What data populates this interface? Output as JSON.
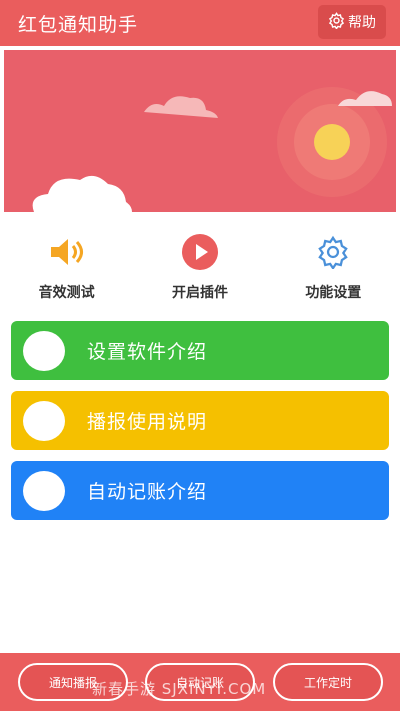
{
  "header": {
    "title": "红包通知助手",
    "help_label": "帮助",
    "help_icon": "gear-icon"
  },
  "colors": {
    "header": "#ea5d5d",
    "banner": "#e8606a",
    "card_green": "#3fbf3f",
    "card_yellow": "#f5c000",
    "card_blue": "#2082f6",
    "action_icon": "#f5a623",
    "play_icon": "#ea5d5d",
    "settings_icon": "#4a90d9"
  },
  "actions": [
    {
      "label": "音效测试",
      "icon": "speaker-icon"
    },
    {
      "label": "开启插件",
      "icon": "play-icon"
    },
    {
      "label": "功能设置",
      "icon": "settings-icon"
    }
  ],
  "cards": [
    {
      "label": "设置软件介绍"
    },
    {
      "label": "播报使用说明"
    },
    {
      "label": "自动记账介绍"
    }
  ],
  "bottom": [
    {
      "label": "通知播报"
    },
    {
      "label": "自动记账"
    },
    {
      "label": "工作定时"
    }
  ],
  "watermark": "新春手游  SJXINYI.COM"
}
